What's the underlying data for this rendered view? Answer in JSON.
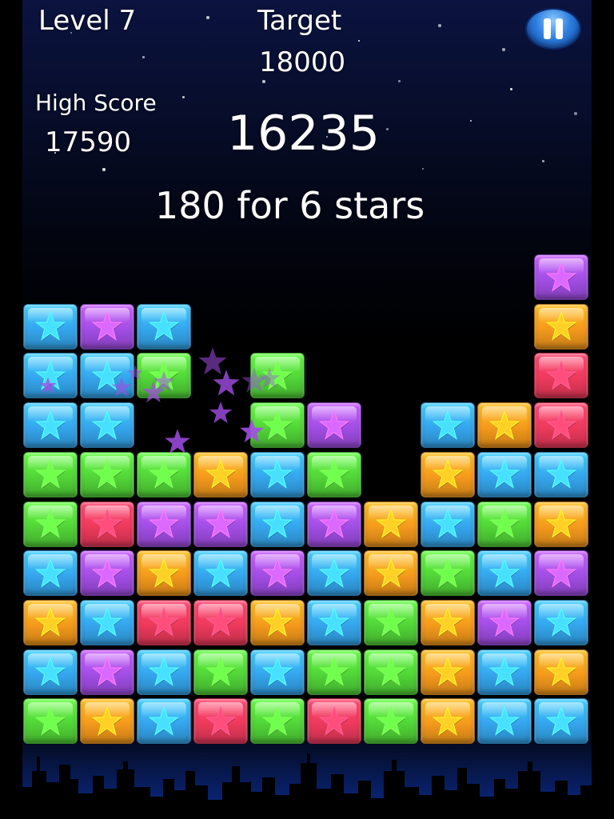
{
  "hud": {
    "level": "Level 7",
    "target_label": "Target",
    "target_value": "18000",
    "high_score_label": "High Score",
    "high_score_value": "17590",
    "score": "16235",
    "bonus_text": "180 for 6 stars"
  },
  "pause_button": {
    "icon": "pause-icon"
  },
  "colors": {
    "blue": "#35a6ee",
    "purple": "#a24ee6",
    "green": "#52d638",
    "orange": "#f59a1c",
    "red": "#ee3a5c",
    "background": "#000000"
  },
  "board": {
    "columns": 10,
    "rows": [
      [
        null,
        null,
        null,
        null,
        null,
        null,
        null,
        null,
        null,
        "purple"
      ],
      [
        "blue",
        "purple",
        "blue",
        null,
        null,
        null,
        null,
        null,
        null,
        "orange"
      ],
      [
        "blue",
        "blue",
        "green",
        null,
        "green",
        null,
        null,
        null,
        null,
        "red"
      ],
      [
        "blue",
        "blue",
        null,
        null,
        "green",
        "purple",
        null,
        "blue",
        "orange",
        "red"
      ],
      [
        "green",
        "green",
        "green",
        "orange",
        "blue",
        "green",
        null,
        "orange",
        "blue",
        "blue"
      ],
      [
        "green",
        "red",
        "purple",
        "purple",
        "blue",
        "purple",
        "orange",
        "blue",
        "green",
        "orange"
      ],
      [
        "blue",
        "purple",
        "orange",
        "blue",
        "purple",
        "blue",
        "orange",
        "green",
        "blue",
        "purple"
      ],
      [
        "orange",
        "blue",
        "red",
        "red",
        "orange",
        "blue",
        "green",
        "orange",
        "purple",
        "blue"
      ],
      [
        "blue",
        "purple",
        "blue",
        "green",
        "blue",
        "green",
        "green",
        "orange",
        "blue",
        "orange"
      ],
      [
        "green",
        "orange",
        "blue",
        "red",
        "green",
        "red",
        "green",
        "orange",
        "blue",
        "blue"
      ]
    ]
  },
  "popped_stars_effect": {
    "color": "purple",
    "count": 12
  }
}
